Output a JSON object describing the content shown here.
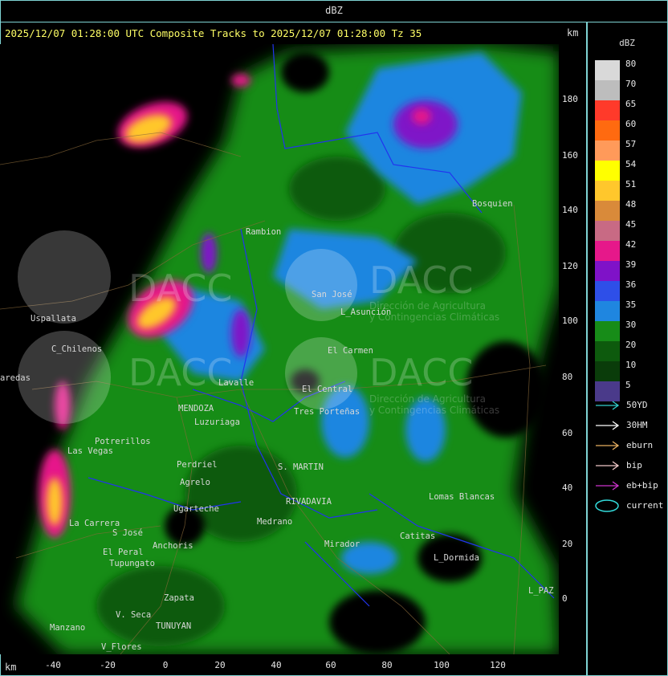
{
  "window": {
    "title": "dBZ"
  },
  "header": {
    "text": "2025/12/07 01:28:00 UTC Composite Tracks to 2025/12/07 01:28:00 Tz 35",
    "km_label": "km"
  },
  "axes": {
    "x_label": "km",
    "x_ticks": [
      "-40",
      "-20",
      "0",
      "20",
      "40",
      "60",
      "80",
      "100",
      "120"
    ],
    "y_ticks": [
      "180",
      "160",
      "140",
      "120",
      "100",
      "80",
      "60",
      "40",
      "20",
      "0"
    ]
  },
  "legend": {
    "title": "dBZ",
    "levels": [
      {
        "label": "80",
        "color": "#d9d9d9"
      },
      {
        "label": "70",
        "color": "#bdbdbd"
      },
      {
        "label": "65",
        "color": "#ff3a2a"
      },
      {
        "label": "60",
        "color": "#ff6a10"
      },
      {
        "label": "57",
        "color": "#ff9a5a"
      },
      {
        "label": "54",
        "color": "#ffff00"
      },
      {
        "label": "51",
        "color": "#ffc72c"
      },
      {
        "label": "48",
        "color": "#d98a3a"
      },
      {
        "label": "45",
        "color": "#c86a84"
      },
      {
        "label": "42",
        "color": "#e6188a"
      },
      {
        "label": "39",
        "color": "#7f12c8"
      },
      {
        "label": "36",
        "color": "#2e4fe8"
      },
      {
        "label": "35",
        "color": "#1f86e0"
      },
      {
        "label": "30",
        "color": "#178c18"
      },
      {
        "label": "20",
        "color": "#0d5a0d"
      },
      {
        "label": "10",
        "color": "#0a3c0a"
      },
      {
        "label": "5",
        "color": "#4a3a8a"
      }
    ],
    "tracks": [
      {
        "label": "50YD",
        "color": "#33cccc"
      },
      {
        "label": "30HM",
        "color": "#ffffff"
      },
      {
        "label": "eburn",
        "color": "#e8b060"
      },
      {
        "label": "bip",
        "color": "#f0c8c8"
      },
      {
        "label": "eb+bip",
        "color": "#cc33cc"
      },
      {
        "label": "current",
        "color": "#33dddd"
      }
    ]
  },
  "map": {
    "watermark": "DACC",
    "watermark_sub1": "Dirección de Agricultura",
    "watermark_sub2": "y Contingencias Climáticas",
    "places": [
      {
        "name": "Uspallata"
      },
      {
        "name": "C_Chilenos"
      },
      {
        "name": "aredas"
      },
      {
        "name": "Rambion"
      },
      {
        "name": "San José"
      },
      {
        "name": "L_Asunción"
      },
      {
        "name": "El Carmen"
      },
      {
        "name": "El Central"
      },
      {
        "name": "MENDOZA"
      },
      {
        "name": "Luzuriaga"
      },
      {
        "name": "Potrerillos"
      },
      {
        "name": "Las Vegas"
      },
      {
        "name": "Perdriel"
      },
      {
        "name": "Agrelo"
      },
      {
        "name": "Ugarteche"
      },
      {
        "name": "S. MARTIN"
      },
      {
        "name": "Medrano"
      },
      {
        "name": "RIVADAVIA"
      },
      {
        "name": "Lomas Blancas"
      },
      {
        "name": "Catitas"
      },
      {
        "name": "L_Dormida"
      },
      {
        "name": "La Carrera"
      },
      {
        "name": "S José"
      },
      {
        "name": "Anchoris"
      },
      {
        "name": "El Peral"
      },
      {
        "name": "Tupungato"
      },
      {
        "name": "V. Seca"
      },
      {
        "name": "Zapata"
      },
      {
        "name": "TUNUYAN"
      },
      {
        "name": "Manzano"
      },
      {
        "name": "V_Flores"
      },
      {
        "name": "L_PAZ"
      },
      {
        "name": "Mirador"
      },
      {
        "name": "Bosquien"
      },
      {
        "name": "Tres Porteñas"
      },
      {
        "name": "Lavalle"
      }
    ]
  }
}
